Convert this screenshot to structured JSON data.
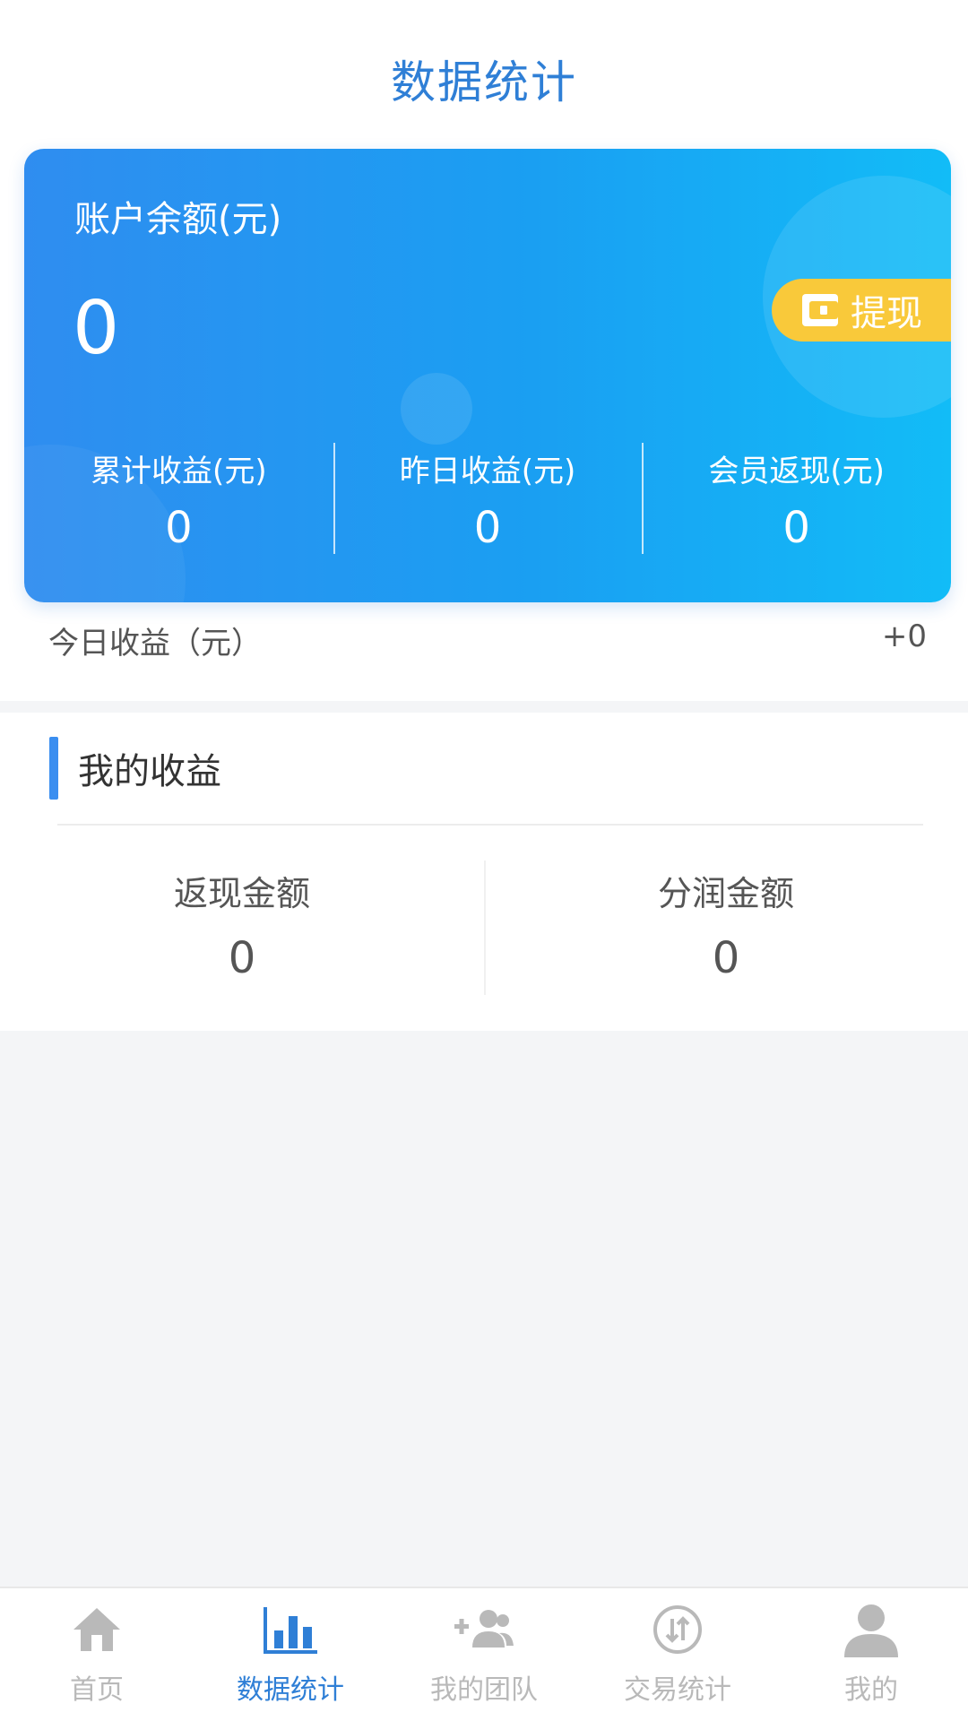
{
  "header": {
    "title": "数据统计"
  },
  "balance_card": {
    "label": "账户余额(元)",
    "value": "0",
    "withdraw_label": "提现",
    "stats": [
      {
        "label": "累计收益(元)",
        "value": "0"
      },
      {
        "label": "昨日收益(元)",
        "value": "0"
      },
      {
        "label": "会员返现(元)",
        "value": "0"
      }
    ]
  },
  "today": {
    "label": "今日收益（元）",
    "value": "+0"
  },
  "earnings": {
    "title": "我的收益",
    "items": [
      {
        "label": "返现金额",
        "value": "0"
      },
      {
        "label": "分润金额",
        "value": "0"
      }
    ]
  },
  "tabbar": {
    "items": [
      {
        "label": "首页",
        "icon": "home-icon"
      },
      {
        "label": "数据统计",
        "icon": "bar-chart-icon",
        "active": true
      },
      {
        "label": "我的团队",
        "icon": "add-team-icon"
      },
      {
        "label": "交易统计",
        "icon": "transfer-icon"
      },
      {
        "label": "我的",
        "icon": "user-icon"
      }
    ]
  },
  "colors": {
    "accent": "#2f7fd6",
    "card_start": "#2f8df0",
    "card_end": "#12bcf7",
    "withdraw": "#f9c93a",
    "tab_inactive": "#b9b9b9"
  }
}
